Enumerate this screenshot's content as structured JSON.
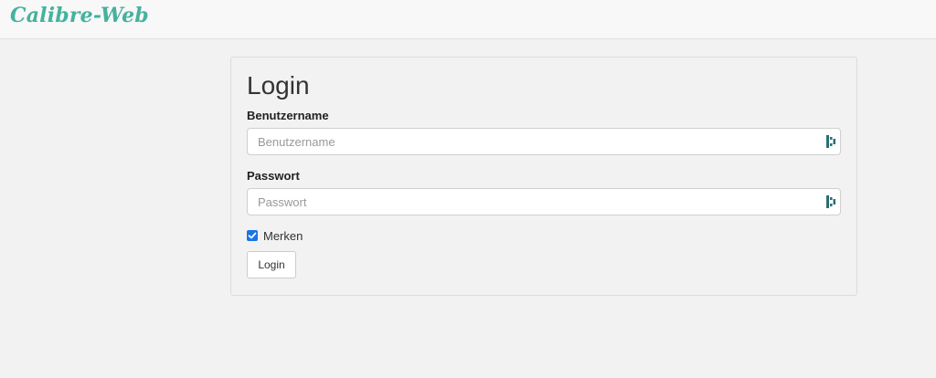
{
  "app": {
    "brand": "Calibre-Web",
    "accent_color": "#45b29d"
  },
  "login_form": {
    "title": "Login",
    "username": {
      "label": "Benutzername",
      "placeholder": "Benutzername",
      "value": "",
      "icon": "password-manager-icon"
    },
    "password": {
      "label": "Passwort",
      "placeholder": "Passwort",
      "value": "",
      "icon": "password-manager-icon"
    },
    "remember": {
      "label": "Merken",
      "checked": true,
      "checkbox_color": "#1a73e8"
    },
    "submit_label": "Login"
  }
}
